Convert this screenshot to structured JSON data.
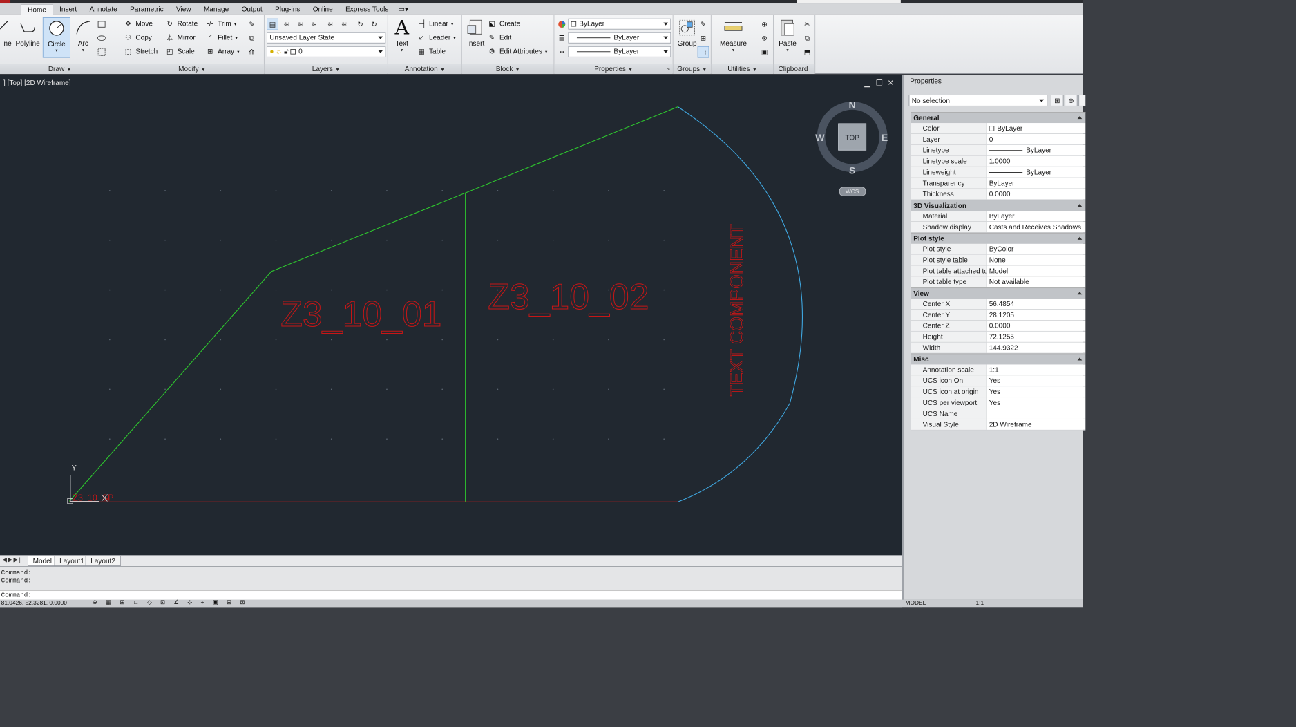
{
  "ribbon": {
    "tabs": [
      "Home",
      "Insert",
      "Annotate",
      "Parametric",
      "View",
      "Manage",
      "Output",
      "Plug-ins",
      "Online",
      "Express Tools"
    ],
    "active_tab": "Home",
    "draw": {
      "title": "Draw",
      "line": "ine",
      "polyline": "Polyline",
      "circle": "Circle",
      "arc": "Arc"
    },
    "modify": {
      "title": "Modify",
      "move": "Move",
      "rotate": "Rotate",
      "trim": "Trim",
      "copy": "Copy",
      "mirror": "Mirror",
      "fillet": "Fillet",
      "stretch": "Stretch",
      "scale": "Scale",
      "array": "Array"
    },
    "layers": {
      "title": "Layers",
      "layer_state": "Unsaved Layer State",
      "current_layer": "0"
    },
    "annotation": {
      "title": "Annotation",
      "text": "Text",
      "linear": "Linear",
      "leader": "Leader",
      "table": "Table"
    },
    "block": {
      "title": "Block",
      "insert": "Insert",
      "create": "Create",
      "edit": "Edit",
      "edit_attributes": "Edit Attributes"
    },
    "properties": {
      "title": "Properties",
      "color": "ByLayer",
      "lineweight": "ByLayer",
      "linetype": "ByLayer"
    },
    "groups": {
      "title": "Groups",
      "group": "Group"
    },
    "utilities": {
      "title": "Utilities",
      "measure": "Measure"
    },
    "clipboard": {
      "title": "Clipboard",
      "paste": "Paste"
    }
  },
  "viewport": {
    "label": "] [Top] [2D Wireframe]",
    "viewcube": {
      "n": "N",
      "s": "S",
      "e": "E",
      "w": "W",
      "face": "TOP",
      "wcs": "WCS"
    },
    "labels": {
      "room1": "Z3_10_01",
      "room2": "Z3_10_02",
      "vertical": "TEXT COMPONENT",
      "small": "Z3_10_SP",
      "ucs_y": "Y"
    }
  },
  "layout_tabs": [
    "Model",
    "Layout1",
    "Layout2"
  ],
  "command": {
    "lines": [
      "Command:",
      "Command:"
    ],
    "prompt": "Command:"
  },
  "status": {
    "coords": "81.0426, 52.3281, 0.0000",
    "model": "MODEL",
    "scale": "1:1"
  },
  "properties_palette": {
    "title": "Properties",
    "selection": "No selection",
    "sections": [
      {
        "name": "General",
        "rows": [
          [
            "Color",
            "ByLayer"
          ],
          [
            "Layer",
            "0"
          ],
          [
            "Linetype",
            "ByLayer"
          ],
          [
            "Linetype scale",
            "1.0000"
          ],
          [
            "Lineweight",
            "ByLayer"
          ],
          [
            "Transparency",
            "ByLayer"
          ],
          [
            "Thickness",
            "0.0000"
          ]
        ]
      },
      {
        "name": "3D Visualization",
        "rows": [
          [
            "Material",
            "ByLayer"
          ],
          [
            "Shadow display",
            "Casts and Receives Shadows"
          ]
        ]
      },
      {
        "name": "Plot style",
        "rows": [
          [
            "Plot style",
            "ByColor"
          ],
          [
            "Plot style table",
            "None"
          ],
          [
            "Plot table attached to",
            "Model"
          ],
          [
            "Plot table type",
            "Not available"
          ]
        ]
      },
      {
        "name": "View",
        "rows": [
          [
            "Center X",
            "56.4854"
          ],
          [
            "Center Y",
            "28.1205"
          ],
          [
            "Center Z",
            "0.0000"
          ],
          [
            "Height",
            "72.1255"
          ],
          [
            "Width",
            "144.9322"
          ]
        ]
      },
      {
        "name": "Misc",
        "rows": [
          [
            "Annotation scale",
            "1:1"
          ],
          [
            "UCS icon On",
            "Yes"
          ],
          [
            "UCS icon at origin",
            "Yes"
          ],
          [
            "UCS per viewport",
            "Yes"
          ],
          [
            "UCS Name",
            ""
          ],
          [
            "Visual Style",
            "2D Wireframe"
          ]
        ]
      }
    ]
  },
  "colors": {
    "viewport_bg": "#212830",
    "green_line": "#2ec82e",
    "red_line": "#d01818",
    "cyan_arc": "#3fa7e0",
    "label_red": "#c81616"
  }
}
